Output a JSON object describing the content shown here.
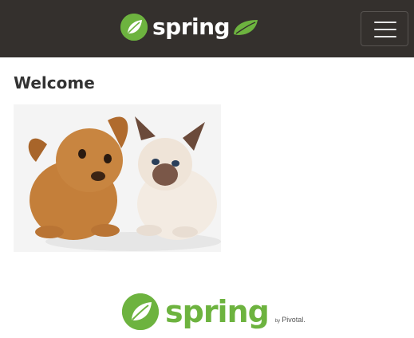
{
  "navbar": {
    "brand_text": "spring",
    "brand_icon": "spring-leaf-icon",
    "boot_icon": "spring-boot-leaf-icon",
    "toggle_icon": "hamburger-menu-icon",
    "background_color": "#34302d",
    "accent_color": "#6db33f"
  },
  "main": {
    "title": "Welcome",
    "image_alt": "pets-image"
  },
  "footer": {
    "logo_text": "spring",
    "by_text": "by",
    "pivotal_text": "Pivotal."
  }
}
